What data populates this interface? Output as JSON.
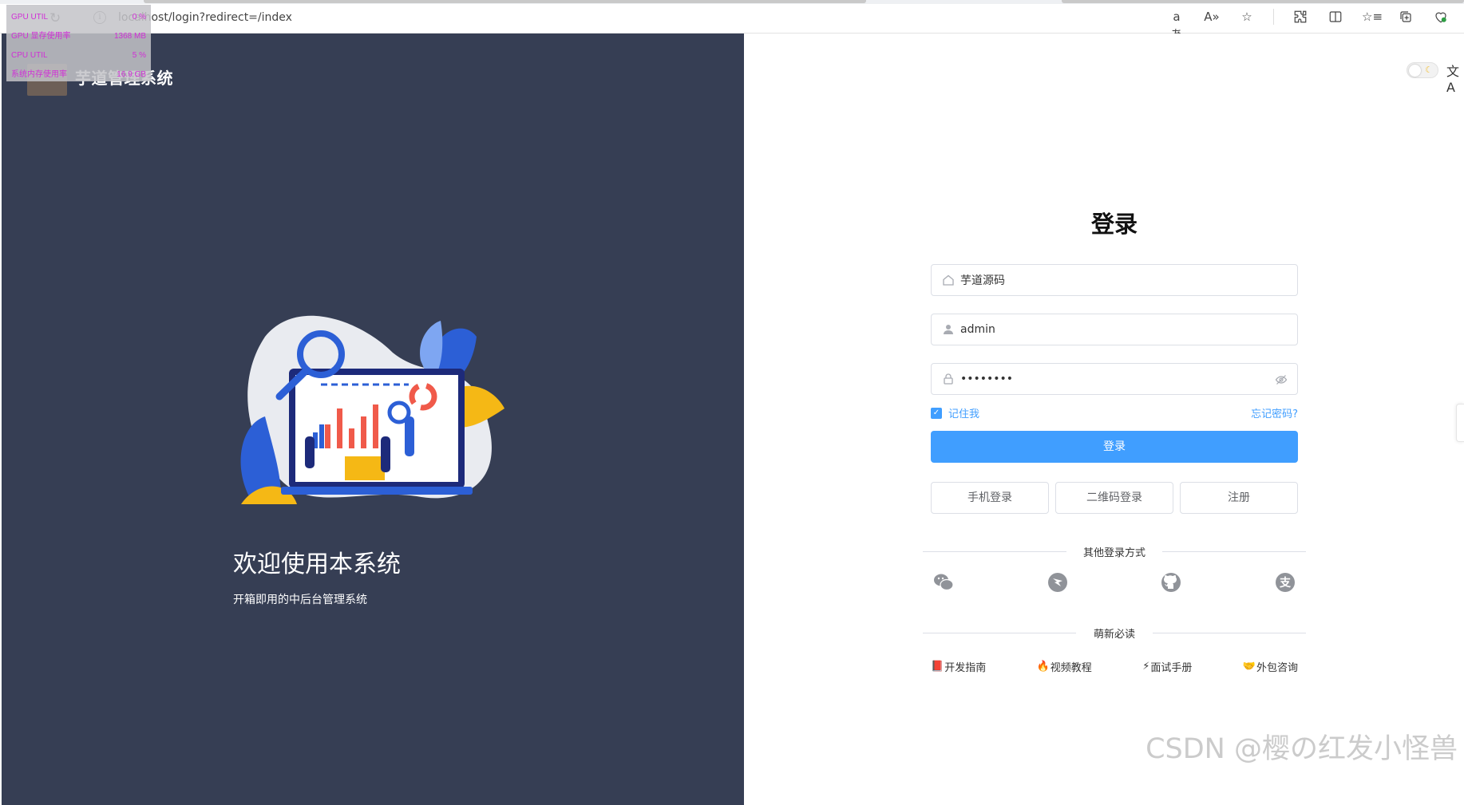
{
  "browser": {
    "url": "localhost/login?redirect=/index"
  },
  "overlay": {
    "rows": [
      {
        "label": "GPU UTIL",
        "value": "0 %"
      },
      {
        "label": "GPU 显存使用率",
        "value": "1368 MB"
      },
      {
        "label": "CPU UTIL",
        "value": "5 %"
      },
      {
        "label": "系统内存使用率",
        "value": "16.9 GB"
      }
    ]
  },
  "left": {
    "brand": "芋道管理系统",
    "welcome": "欢迎使用本系统",
    "subtitle": "开箱即用的中后台管理系统"
  },
  "login": {
    "title": "登录",
    "tenant_value": "芋道源码",
    "username_value": "admin",
    "password_value": "••••••••",
    "remember_label": "记住我",
    "forgot_label": "忘记密码?",
    "submit_label": "登录",
    "alt_buttons": [
      "手机登录",
      "二维码登录",
      "注册"
    ],
    "other_methods_label": "其他登录方式",
    "must_read_label": "萌新必读",
    "links": [
      {
        "emoji": "📕",
        "label": "开发指南"
      },
      {
        "emoji": "🔥",
        "label": "视频教程"
      },
      {
        "emoji": "⚡",
        "label": "面试手册"
      },
      {
        "emoji": "🤝",
        "label": "外包咨询"
      }
    ]
  },
  "colors": {
    "primary": "#409eff",
    "left_bg": "#363e54"
  },
  "watermark": "CSDN @樱の红发小怪兽"
}
